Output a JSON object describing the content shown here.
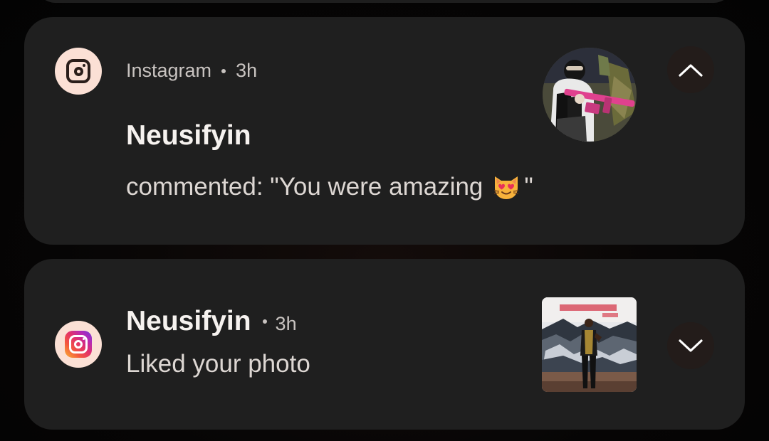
{
  "notifications": [
    {
      "app_name": "Instagram",
      "time": "3h",
      "title": "Neusifyin",
      "body_prefix": "commented: \"You were amazing",
      "body_emoji": "smiling-cat-heart-eyes-emoji",
      "body_suffix": "\"",
      "app_icon": "instagram-mono-icon",
      "expanded": true,
      "chevron_icon": "chevron-up-icon"
    },
    {
      "title": "Neusifyin",
      "time": "3h",
      "body": "Liked your photo",
      "app_icon": "instagram-color-icon",
      "expanded": false,
      "chevron_icon": "chevron-down-icon"
    }
  ],
  "colors": {
    "card_background": "#1f1f1f",
    "icon_background": "#fbe0d5",
    "title_text": "#f6f2ef",
    "secondary_text": "#c8c3c0"
  }
}
